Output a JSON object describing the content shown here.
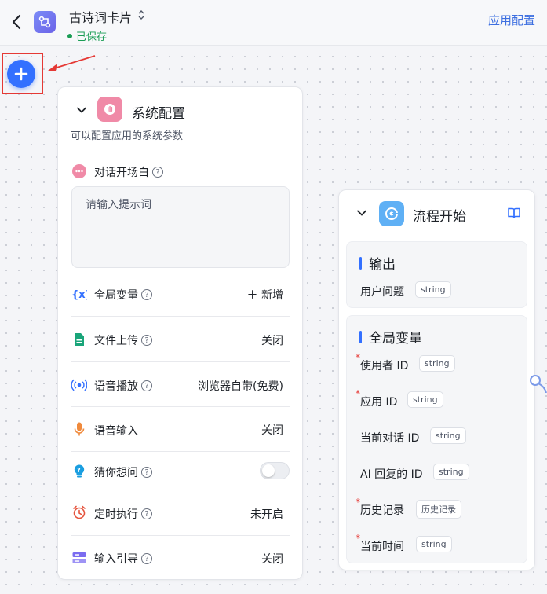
{
  "header": {
    "back_icon": "chevron-left-icon",
    "app_icon": "workflow-app-icon",
    "app_title": "古诗词卡片",
    "status": "已保存",
    "app_config_link": "应用配置"
  },
  "canvas": {
    "add_node_icon": "plus-icon"
  },
  "system_config": {
    "title": "系统配置",
    "description": "可以配置应用的系统参数",
    "opening": {
      "label": "对话开场白",
      "placeholder": "请输入提示词"
    },
    "rows": [
      {
        "name": "global-variables",
        "icon": "variable-icon",
        "label": "全局变量",
        "value": "＋ 新增"
      },
      {
        "name": "file-upload",
        "icon": "file-icon",
        "label": "文件上传",
        "value": "关闭"
      },
      {
        "name": "voice-playback",
        "icon": "broadcast-icon",
        "label": "语音播放",
        "value": "浏览器自带(免费)"
      },
      {
        "name": "voice-input",
        "icon": "microphone-icon",
        "label": "语音输入",
        "value": "关闭"
      },
      {
        "name": "guess-question",
        "icon": "lightbulb-question-icon",
        "label": "猜你想问",
        "value": ""
      },
      {
        "name": "scheduled-run",
        "icon": "alarm-clock-icon",
        "label": "定时执行",
        "value": "未开启"
      },
      {
        "name": "input-guide",
        "icon": "input-guide-icon",
        "label": "输入引导",
        "value": "关闭"
      }
    ],
    "guess_question_enabled": false
  },
  "flow_start": {
    "title": "流程开始",
    "output": {
      "title": "输出",
      "items": [
        {
          "label": "用户问题",
          "type": "string"
        }
      ]
    },
    "global_vars": {
      "title": "全局变量",
      "items": [
        {
          "label": "使用者 ID",
          "type": "string",
          "required": true
        },
        {
          "label": "应用 ID",
          "type": "string",
          "required": true
        },
        {
          "label": "当前对话 ID",
          "type": "string",
          "required": false
        },
        {
          "label": "AI 回复的 ID",
          "type": "string",
          "required": false
        },
        {
          "label": "历史记录",
          "type": "历史记录",
          "required": true
        },
        {
          "label": "当前时间",
          "type": "string",
          "required": true
        }
      ]
    }
  },
  "colors": {
    "accent": "#3370ff",
    "saved": "#1a9d55",
    "highlight_box": "#e53935",
    "system_icon_bg": "#f08aa7",
    "flow_icon_bg": "#5fb0f5"
  }
}
